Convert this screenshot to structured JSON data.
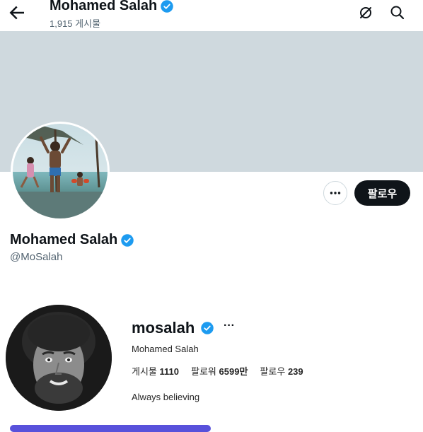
{
  "header": {
    "title": "Mohamed Salah",
    "post_count": "1,915 게시물",
    "back_icon": "arrow-left-icon",
    "icons": [
      "grok-circle-icon",
      "search-icon"
    ]
  },
  "profile": {
    "name": "Mohamed Salah",
    "handle": "@MoSalah",
    "follow_label": "팔로우",
    "more_icon": "more-horizontal-icon",
    "verified_color": "#1d9bf0"
  },
  "instagram": {
    "username": "mosalah",
    "full_name": "Mohamed Salah",
    "stats": {
      "posts_label": "게시물",
      "posts": "1110",
      "followers_label": "팔로워",
      "followers": "6599만",
      "following_label": "팔로우",
      "following": "239"
    },
    "bio": "Always believing",
    "more_label": "···"
  }
}
